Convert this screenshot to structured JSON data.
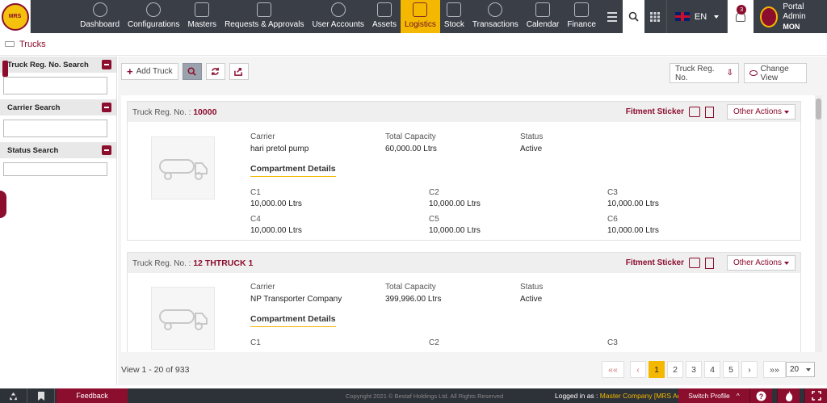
{
  "nav": {
    "items": [
      {
        "label": "Dashboard",
        "icon": "dashboard-icon"
      },
      {
        "label": "Configurations",
        "icon": "gear-icon"
      },
      {
        "label": "Masters",
        "icon": "masters-icon"
      },
      {
        "label": "Requests & Approvals",
        "icon": "request-icon"
      },
      {
        "label": "User Accounts",
        "icon": "users-icon"
      },
      {
        "label": "Assets",
        "icon": "assets-icon"
      },
      {
        "label": "Logistics",
        "icon": "truck-icon",
        "active": true
      },
      {
        "label": "Stock",
        "icon": "stock-icon"
      },
      {
        "label": "Transactions",
        "icon": "transactions-icon"
      },
      {
        "label": "Calendar",
        "icon": "calendar-icon"
      },
      {
        "label": "Finance",
        "icon": "finance-icon"
      }
    ],
    "language": "EN",
    "notifications": "3",
    "user_name": "Portal Admin",
    "user_code": "MON"
  },
  "breadcrumb": {
    "title": "Trucks"
  },
  "filters": {
    "reg_search": "Truck Reg. No. Search",
    "carrier_search": "Carrier Search",
    "status_search": "Status Search"
  },
  "toolbar": {
    "add_truck": "Add Truck",
    "sort_label": "Truck Reg. No.",
    "change_view": "Change View"
  },
  "cards": [
    {
      "reg_label": "Truck Reg. No. :",
      "reg_no": "10000",
      "fitment": "Fitment Sticker",
      "other_actions": "Other Actions",
      "carrier_label": "Carrier",
      "carrier": "hari pretol pump",
      "capacity_label": "Total Capacity",
      "capacity": "60,000.00 Ltrs",
      "status_label": "Status",
      "status": "Active",
      "compartment_title": "Compartment Details",
      "compartments": [
        {
          "name": "C1",
          "value": "10,000.00 Ltrs"
        },
        {
          "name": "C2",
          "value": "10,000.00 Ltrs"
        },
        {
          "name": "C3",
          "value": "10,000.00 Ltrs"
        },
        {
          "name": "C4",
          "value": "10,000.00 Ltrs"
        },
        {
          "name": "C5",
          "value": "10,000.00 Ltrs"
        },
        {
          "name": "C6",
          "value": "10,000.00 Ltrs"
        }
      ]
    },
    {
      "reg_label": "Truck Reg. No. :",
      "reg_no": "12 THTRUCK 1",
      "fitment": "Fitment Sticker",
      "other_actions": "Other Actions",
      "carrier_label": "Carrier",
      "carrier": "NP Transporter Company",
      "capacity_label": "Total Capacity",
      "capacity": "399,996.00 Ltrs",
      "status_label": "Status",
      "status": "Active",
      "compartment_title": "Compartment Details",
      "compartments": [
        {
          "name": "C1",
          "value": ""
        },
        {
          "name": "C2",
          "value": ""
        },
        {
          "name": "C3",
          "value": ""
        }
      ]
    }
  ],
  "pager": {
    "view_text": "View 1 - 20 of 933",
    "first": "««",
    "prev": "‹",
    "pages": [
      "1",
      "2",
      "3",
      "4",
      "5"
    ],
    "next": "›",
    "last": "»»",
    "page_size": "20"
  },
  "footer": {
    "feedback": "Feedback",
    "copyright": "Copyright 2021 © Bestaf Holdings Ltd. All Rights Reserved",
    "logged_label": "Logged in as :",
    "logged_value": "Master Company [MRS Admin]",
    "switch_profile": "Switch Profile"
  },
  "colors": {
    "brand": "#8b0e2e",
    "accent": "#f5b800",
    "nav": "#3a3f47"
  }
}
